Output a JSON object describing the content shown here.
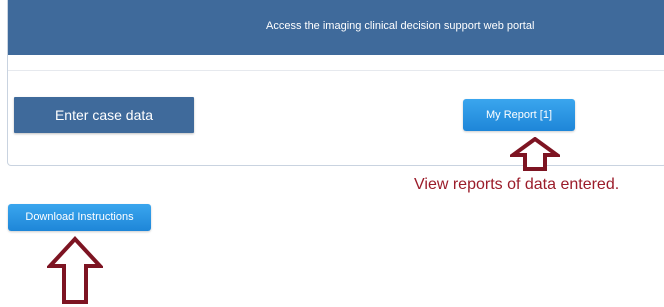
{
  "header": {
    "title": "Access the imaging clinical decision support web portal"
  },
  "buttons": {
    "enter_case": "Enter case data",
    "my_report": "My Report [1]",
    "download_instructions": "Download Instructions"
  },
  "annotations": {
    "report_note": "View reports of data entered."
  },
  "icons": {
    "report_arrow": "up-arrow-icon",
    "download_arrow": "up-arrow-icon"
  },
  "colors": {
    "header_bg": "#3f6a9b",
    "primary_button": "#3f6a9b",
    "accent_button": "#2b97e4",
    "annotation": "#9b1c2a"
  }
}
